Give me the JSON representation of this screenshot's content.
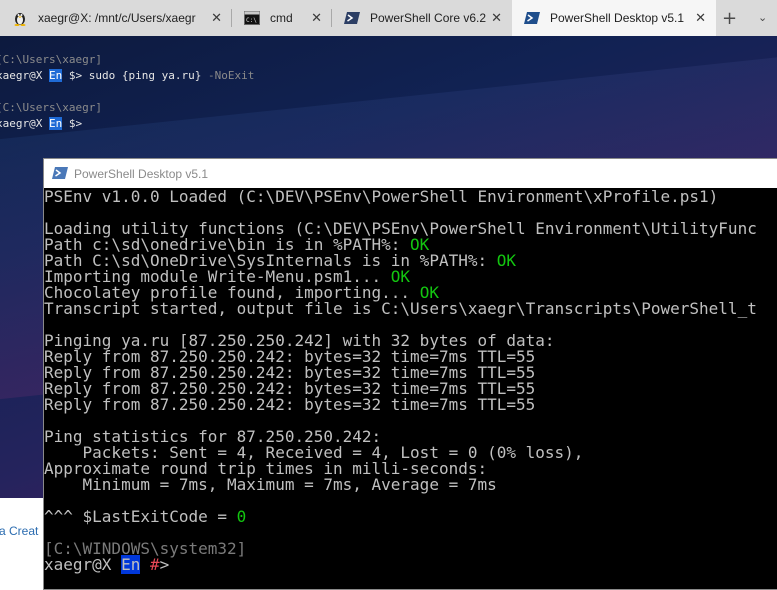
{
  "tabs": [
    {
      "label": "xaegr@X: /mnt/c/Users/xaegr",
      "icon": "linux-tux-icon",
      "active": false
    },
    {
      "label": "cmd",
      "icon": "cmd-icon",
      "active": false
    },
    {
      "label": "PowerShell Core v6.2",
      "icon": "powershell-icon",
      "active": false
    },
    {
      "label": "PowerShell Desktop v5.1",
      "icon": "powershell-icon",
      "active": true
    }
  ],
  "tab_close_glyph": "✕",
  "new_tab_glyph": "+",
  "dropdown_glyph": "⌄",
  "bg_terminal": {
    "line1_path": "[C:\\Users\\xaegr]",
    "line2_user": "xaegr@X ",
    "line2_lang": "En",
    "line2_prompt": " $> ",
    "line2_cmd": "sudo {ping ya.ru} ",
    "line2_arg": "-NoExit",
    "line3_path": "[C:\\Users\\xaegr]",
    "line4_user": "xaegr@X ",
    "line4_lang": "En",
    "line4_prompt": " $>"
  },
  "background_strip_text": "a Creat",
  "ps_window": {
    "title": "PowerShell Desktop v5.1",
    "lines": {
      "psenv": "PSEnv v1.0.0 Loaded (C:\\DEV\\PSEnv\\PowerShell Environment\\xProfile.ps1)",
      "loading": "Loading utility functions (C:\\DEV\\PSEnv\\PowerShell Environment\\UtilityFunc",
      "path1": "Path c:\\sd\\onedrive\\bin is in %PATH%: ",
      "path2": "Path C:\\sd\\OneDrive\\SysInternals is in %PATH%: ",
      "importing": "Importing module Write-Menu.psm1... ",
      "choco": "Chocolatey profile found, importing... ",
      "ok": "OK",
      "transcript": "Transcript started, output file is C:\\Users\\xaegr\\Transcripts\\PowerShell_t",
      "pinging": "Pinging ya.ru [87.250.250.242] with 32 bytes of data:",
      "reply": "Reply from 87.250.250.242: bytes=32 time=7ms TTL=55",
      "stats": "Ping statistics for 87.250.250.242:",
      "packets": "    Packets: Sent = 4, Received = 4, Lost = 0 (0% loss),",
      "approx": "Approximate round trip times in milli-seconds:",
      "minmax": "    Minimum = 7ms, Maximum = 7ms, Average = 7ms",
      "exitcode_prefix": "^^^ $LastExitCode = ",
      "exitcode_value": "0",
      "cwd": "[C:\\WINDOWS\\system32]",
      "prompt_user": "xaegr@X ",
      "prompt_lang": "En",
      "prompt_hash": " #",
      "prompt_arrow": ">"
    }
  },
  "colors": {
    "ok_green": "#13c610",
    "lang_badge": "#0037da",
    "admin_hash": "#e74856"
  }
}
